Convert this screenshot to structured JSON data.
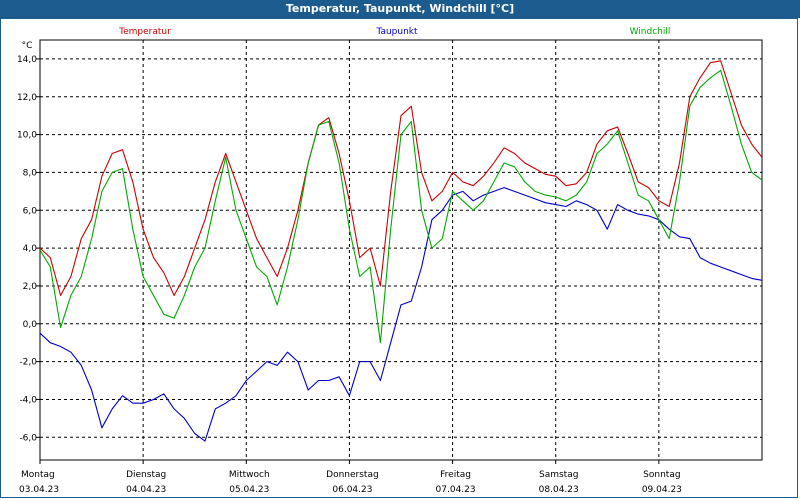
{
  "window": {
    "title": "Temperatur, Taupunkt, Windchill [°C]"
  },
  "chart_data": {
    "type": "line",
    "title": "Temperatur, Taupunkt, Windchill [°C]",
    "ylabel": "°C",
    "ylim": [
      -7.2,
      15
    ],
    "xlim": [
      0,
      7
    ],
    "y_ticks": [
      "14,0",
      "12,0",
      "10,0",
      "8,0",
      "6,0",
      "4,0",
      "2,0",
      "0,0",
      "-2,0",
      "-4,0",
      "-6,0"
    ],
    "y_tick_values": [
      14,
      12,
      10,
      8,
      6,
      4,
      2,
      0,
      -2,
      -4,
      -6
    ],
    "x_ticks": [
      {
        "day": "Montag",
        "date": "03.04.23"
      },
      {
        "day": "Dienstag",
        "date": "04.04.23"
      },
      {
        "day": "Mittwoch",
        "date": "05.04.23"
      },
      {
        "day": "Donnerstag",
        "date": "06.04.23"
      },
      {
        "day": "Freitag",
        "date": "07.04.23"
      },
      {
        "day": "Samstag",
        "date": "08.04.23"
      },
      {
        "day": "Sonntag",
        "date": "09.04.23"
      }
    ],
    "grid": true,
    "legend": "top",
    "x": [
      0,
      0.1,
      0.2,
      0.3,
      0.4,
      0.5,
      0.6,
      0.7,
      0.8,
      0.9,
      1.0,
      1.1,
      1.2,
      1.3,
      1.4,
      1.5,
      1.6,
      1.7,
      1.8,
      1.9,
      2.0,
      2.1,
      2.2,
      2.3,
      2.4,
      2.5,
      2.6,
      2.7,
      2.8,
      2.9,
      3.0,
      3.1,
      3.2,
      3.3,
      3.4,
      3.5,
      3.6,
      3.7,
      3.8,
      3.9,
      4.0,
      4.1,
      4.2,
      4.3,
      4.4,
      4.5,
      4.6,
      4.7,
      4.8,
      4.9,
      5.0,
      5.1,
      5.2,
      5.3,
      5.4,
      5.5,
      5.6,
      5.7,
      5.8,
      5.9,
      6.0,
      6.1,
      6.2,
      6.3,
      6.4,
      6.5,
      6.6,
      6.7,
      6.8,
      6.9,
      7.0
    ],
    "series": [
      {
        "name": "Temperatur",
        "color": "#cc0000",
        "values": [
          4.0,
          3.5,
          1.5,
          2.5,
          4.5,
          5.5,
          7.8,
          9.0,
          9.2,
          7.5,
          5.0,
          3.5,
          2.7,
          1.5,
          2.5,
          4.0,
          5.5,
          7.5,
          9.0,
          7.5,
          6.0,
          4.5,
          3.5,
          2.5,
          4.0,
          6.0,
          8.5,
          10.5,
          10.9,
          9.0,
          6.5,
          3.5,
          4.0,
          2.0,
          7.0,
          11.0,
          11.5,
          8.0,
          6.5,
          7.0,
          8.0,
          7.5,
          7.3,
          7.8,
          8.5,
          9.3,
          9.0,
          8.5,
          8.2,
          7.9,
          7.8,
          7.3,
          7.4,
          8.0,
          9.5,
          10.2,
          10.4,
          9.0,
          7.5,
          7.2,
          6.5,
          6.2,
          8.5,
          12.0,
          13.0,
          13.8,
          13.9,
          12.2,
          10.5,
          9.5,
          8.8
        ]
      },
      {
        "name": "Taupunkt",
        "color": "#0000cc",
        "values": [
          -0.5,
          -1.0,
          -1.2,
          -1.5,
          -2.2,
          -3.5,
          -5.5,
          -4.5,
          -3.8,
          -4.2,
          -4.2,
          -4.0,
          -3.7,
          -4.5,
          -5.0,
          -5.8,
          -6.2,
          -4.5,
          -4.2,
          -3.8,
          -3.0,
          -2.5,
          -2.0,
          -2.2,
          -1.5,
          -2.0,
          -3.5,
          -3.0,
          -3.0,
          -2.8,
          -3.8,
          -2.0,
          -2.0,
          -3.0,
          -1.0,
          1.0,
          1.2,
          3.0,
          5.5,
          6.0,
          6.8,
          7.0,
          6.5,
          6.8,
          7.0,
          7.2,
          7.0,
          6.8,
          6.6,
          6.4,
          6.3,
          6.2,
          6.5,
          6.3,
          6.0,
          5.0,
          6.3,
          6.0,
          5.8,
          5.7,
          5.5,
          5.0,
          4.6,
          4.5,
          3.5,
          3.2,
          3.0,
          2.8,
          2.6,
          2.4,
          2.3
        ]
      },
      {
        "name": "Windchill",
        "color": "#00aa00",
        "values": [
          3.9,
          3.0,
          -0.2,
          1.5,
          2.5,
          4.5,
          7.0,
          8.0,
          8.2,
          5.0,
          2.5,
          1.5,
          0.5,
          0.3,
          1.5,
          3.0,
          4.0,
          6.5,
          8.8,
          6.0,
          4.5,
          3.0,
          2.5,
          1.0,
          3.0,
          5.5,
          8.5,
          10.5,
          10.7,
          8.5,
          5.0,
          2.5,
          3.0,
          -1.0,
          5.0,
          10.0,
          10.7,
          6.0,
          4.0,
          4.5,
          7.0,
          6.5,
          6.0,
          6.5,
          7.5,
          8.5,
          8.3,
          7.5,
          7.0,
          6.8,
          6.7,
          6.5,
          6.8,
          7.5,
          9.0,
          9.5,
          10.2,
          8.5,
          6.8,
          6.5,
          5.5,
          4.5,
          7.5,
          11.5,
          12.5,
          13.0,
          13.4,
          11.5,
          9.5,
          8.0,
          7.6
        ]
      }
    ]
  }
}
